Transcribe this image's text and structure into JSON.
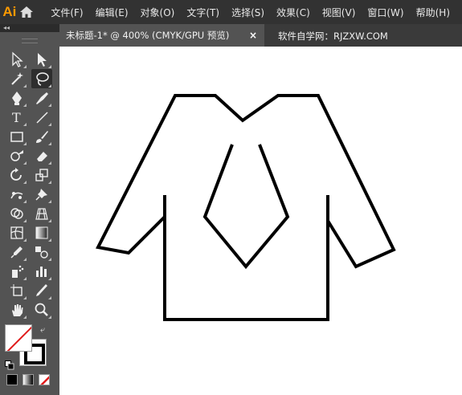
{
  "app": {
    "logo_text": "Ai",
    "brand_color": "#ff9a00"
  },
  "menubar": {
    "items": [
      "文件(F)",
      "编辑(E)",
      "对象(O)",
      "文字(T)",
      "选择(S)",
      "效果(C)",
      "视图(V)",
      "窗口(W)",
      "帮助(H)"
    ]
  },
  "panel": {
    "collapse_glyph": "◂◂"
  },
  "document_tab": {
    "title": "未标题-1* @ 400% (CMYK/GPU 预览)",
    "close_glyph": "×"
  },
  "watermark": "软件自学网：RJZXW.COM",
  "tools": [
    "selection-tool",
    "direct-selection-tool",
    "magic-wand-tool",
    "lasso-tool",
    "pen-tool",
    "curvature-tool",
    "type-tool",
    "line-segment-tool",
    "rectangle-tool",
    "paintbrush-tool",
    "shaper-tool",
    "eraser-tool",
    "rotate-tool",
    "scale-tool",
    "puppet-warp-tool",
    "pin-tool",
    "shape-builder-tool",
    "perspective-grid-tool",
    "mesh-tool",
    "gradient-tool",
    "eyedropper-tool",
    "blend-tool",
    "symbol-sprayer-tool",
    "column-graph-tool",
    "artboard-tool",
    "slice-tool",
    "hand-tool",
    "zoom-tool"
  ],
  "colors": {
    "fill": "none",
    "stroke": "#000000",
    "none_slash": "#e01b1b"
  },
  "drawing": {
    "subject": "shirt-with-tie",
    "stroke": "#000000"
  }
}
